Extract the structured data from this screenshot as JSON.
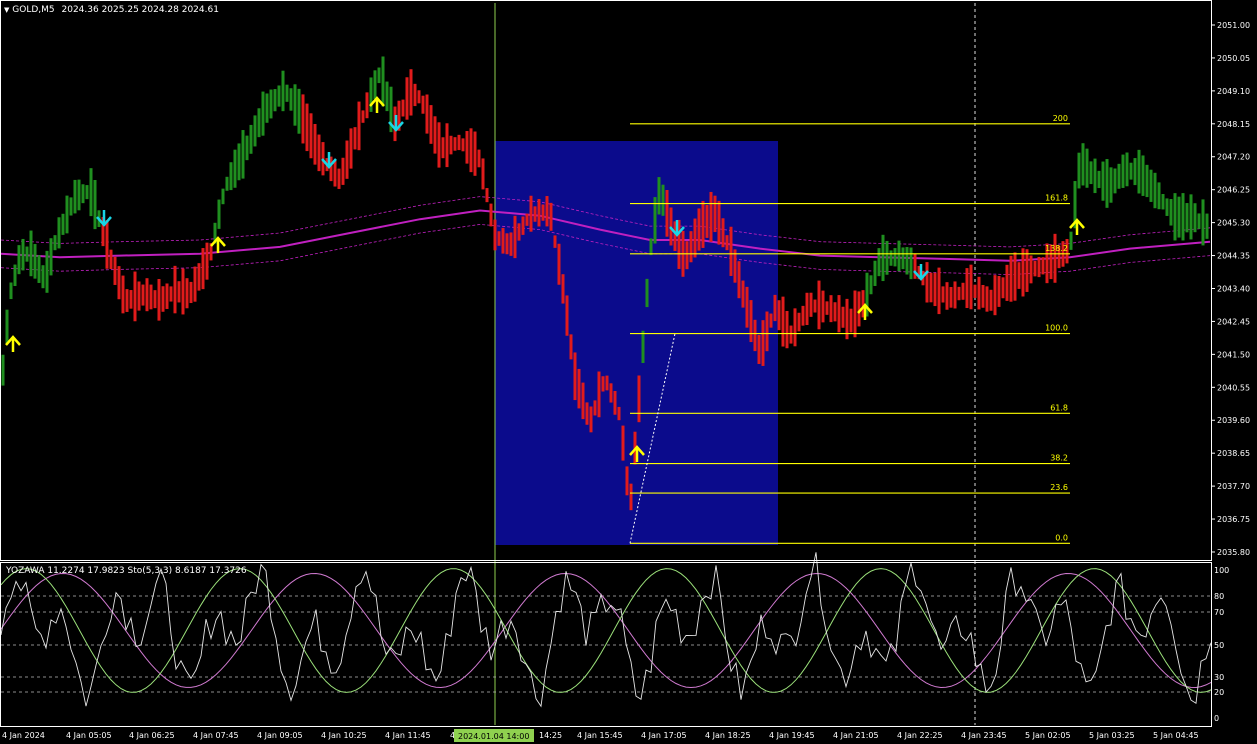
{
  "symbol_header": {
    "symbol": "GOLD,M5",
    "ohlc": "2024.36 2025.25 2024.28 2024.61"
  },
  "indicator_header": {
    "label": "YOZAWA 11.2274 17.9823  Sto(5,3,3) 8.6187 17.3726"
  },
  "price_axis": [
    "2051.00",
    "2050.05",
    "2049.10",
    "2048.15",
    "2047.20",
    "2046.25",
    "2045.30",
    "2044.35",
    "2043.40",
    "2042.45",
    "2041.50",
    "2040.55",
    "2039.60",
    "2038.65",
    "2037.70",
    "2036.75",
    "2035.80"
  ],
  "osc_axis": [
    "100",
    "80",
    "70",
    "50",
    "30",
    "20",
    "0"
  ],
  "time_axis": [
    "4 Jan 2024",
    "4 Jan 05:05",
    "4 Jan 06:25",
    "4 Jan 07:45",
    "4 Jan 09:05",
    "4 Jan 10:25",
    "4 Jan 11:45",
    "4 Jan 13:05",
    "14:25",
    "4 Jan 15:45",
    "4 Jan 17:05",
    "4 Jan 18:25",
    "4 Jan 19:45",
    "4 Jan 21:05",
    "4 Jan 22:25",
    "4 Jan 23:45",
    "5 Jan 02:05",
    "5 Jan 03:25",
    "5 Jan 04:45"
  ],
  "crosshair_time": "2024.01.04 14:00",
  "fib_levels": [
    {
      "label": "200",
      "price": 2048.15
    },
    {
      "label": "161.8",
      "price": 2045.85
    },
    {
      "label": "138.2",
      "price": 2044.4
    },
    {
      "label": "100.0",
      "price": 2042.1
    },
    {
      "label": "61.8",
      "price": 2039.8
    },
    {
      "label": "38.2",
      "price": 2038.35
    },
    {
      "label": "23.6",
      "price": 2037.5
    },
    {
      "label": "0.0",
      "price": 2036.05
    }
  ],
  "colors": {
    "bull": "#1f8f1f",
    "bear": "#e11b1b",
    "ma": "#c020c0",
    "fib": "#ffff00",
    "zone": "#0b0b8c",
    "crosshair": "#8fd14f",
    "arrow_up": "#ffff00",
    "arrow_down": "#19d6e6"
  },
  "icons": {
    "buy_signal": "arrow-up-icon",
    "sell_signal": "arrow-down-icon",
    "menu": "triangle-down-icon"
  }
}
